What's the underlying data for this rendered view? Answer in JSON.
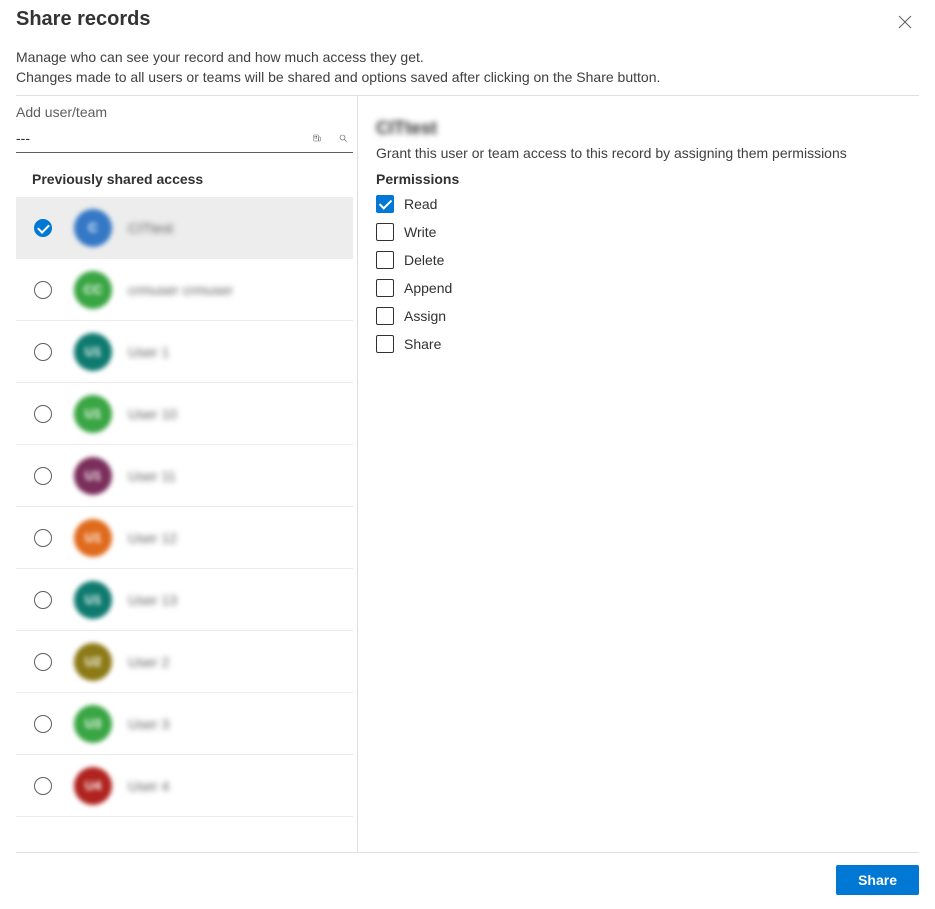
{
  "header": {
    "title": "Share records",
    "desc1": "Manage who can see your record and how much access they get.",
    "desc2": "Changes made to all users or teams will be shared and options saved after clicking on the Share button."
  },
  "search": {
    "label": "Add user/team",
    "value": "---"
  },
  "left": {
    "section_heading": "Previously shared access",
    "users": [
      {
        "name": "CITtest",
        "initials": "C",
        "avatar_color": "#3478c6",
        "selected": true
      },
      {
        "name": "crmuser crmuser",
        "initials": "CC",
        "avatar_color": "#39a543",
        "selected": false
      },
      {
        "name": "User 1",
        "initials": "U1",
        "avatar_color": "#0e7a6f",
        "selected": false
      },
      {
        "name": "User 10",
        "initials": "U1",
        "avatar_color": "#39a543",
        "selected": false
      },
      {
        "name": "User 11",
        "initials": "U1",
        "avatar_color": "#7a2e5b",
        "selected": false
      },
      {
        "name": "User 12",
        "initials": "U1",
        "avatar_color": "#e06a1c",
        "selected": false
      },
      {
        "name": "User 13",
        "initials": "U1",
        "avatar_color": "#0e7a6f",
        "selected": false
      },
      {
        "name": "User 2",
        "initials": "U2",
        "avatar_color": "#8c7a16",
        "selected": false
      },
      {
        "name": "User 3",
        "initials": "U3",
        "avatar_color": "#39a543",
        "selected": false
      },
      {
        "name": "User 4",
        "initials": "U4",
        "avatar_color": "#b0231e",
        "selected": false
      }
    ]
  },
  "right": {
    "selected_name": "CITtest",
    "desc": "Grant this user or team access to this record by assigning them permissions",
    "permissions_heading": "Permissions",
    "permissions": [
      {
        "label": "Read",
        "checked": true
      },
      {
        "label": "Write",
        "checked": false
      },
      {
        "label": "Delete",
        "checked": false
      },
      {
        "label": "Append",
        "checked": false
      },
      {
        "label": "Assign",
        "checked": false
      },
      {
        "label": "Share",
        "checked": false
      }
    ]
  },
  "footer": {
    "share_label": "Share"
  }
}
